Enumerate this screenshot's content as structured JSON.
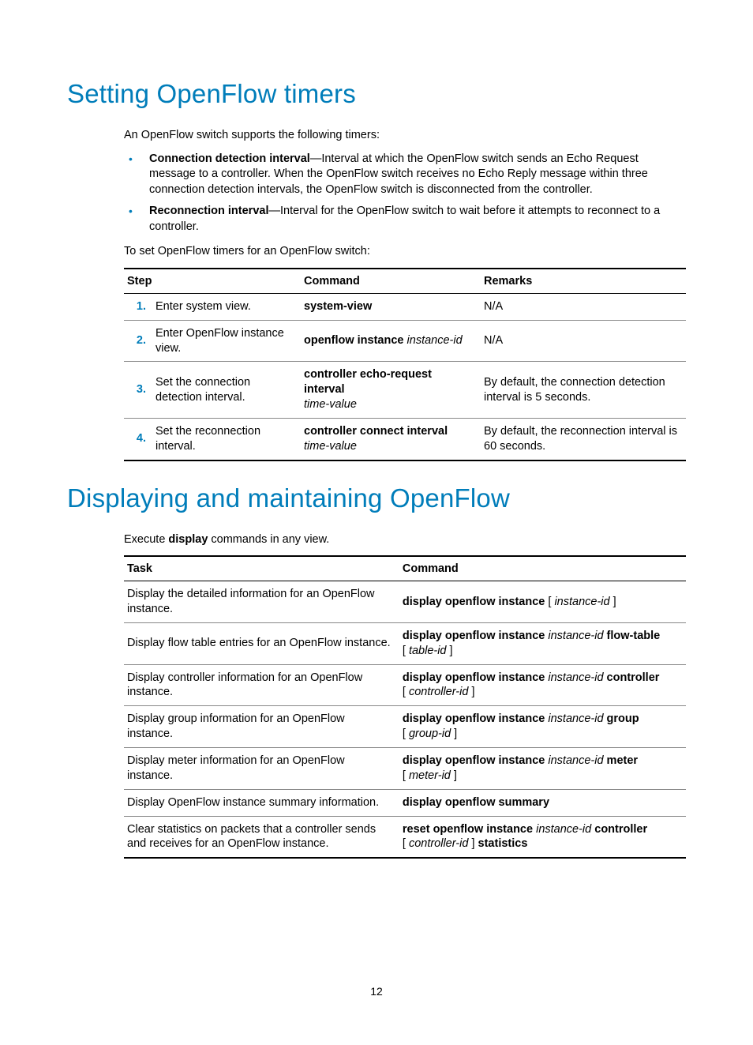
{
  "section1": {
    "heading": "Setting OpenFlow timers",
    "intro": "An OpenFlow switch supports the following timers:",
    "bullets": [
      {
        "label": "Connection detection interval",
        "text": "—Interval at which the OpenFlow switch sends an Echo Request message to a controller. When the OpenFlow switch receives no Echo Reply message within three connection detection intervals, the OpenFlow switch is disconnected from the controller."
      },
      {
        "label": "Reconnection interval",
        "text": "—Interval for the OpenFlow switch to wait before it attempts to reconnect to a controller."
      }
    ],
    "lead": "To set OpenFlow timers for an OpenFlow switch:",
    "table": {
      "headers": [
        "Step",
        "Command",
        "Remarks"
      ],
      "rows": [
        {
          "num": "1.",
          "step": "Enter system view.",
          "cmd": [
            {
              "b": "system-view"
            }
          ],
          "remarks": "N/A"
        },
        {
          "num": "2.",
          "step": "Enter OpenFlow instance view.",
          "cmd": [
            {
              "b": "openflow instance"
            },
            {
              "t": " "
            },
            {
              "i": "instance-id"
            }
          ],
          "remarks": "N/A"
        },
        {
          "num": "3.",
          "step": "Set the connection detection interval.",
          "cmd": [
            {
              "b": "controller echo-request interval"
            },
            {
              "br": true
            },
            {
              "i": "time-value"
            }
          ],
          "remarks": "By default, the connection detection interval is 5 seconds."
        },
        {
          "num": "4.",
          "step": "Set the reconnection interval.",
          "cmd": [
            {
              "b": "controller connect interval"
            },
            {
              "br": true
            },
            {
              "i": "time-value"
            }
          ],
          "remarks": "By default, the reconnection interval is 60 seconds."
        }
      ]
    }
  },
  "section2": {
    "heading": "Displaying and maintaining OpenFlow",
    "lead_pre": "Execute ",
    "lead_bold": "display",
    "lead_post": " commands in any view.",
    "table": {
      "headers": [
        "Task",
        "Command"
      ],
      "rows": [
        {
          "task": "Display the detailed information for an OpenFlow instance.",
          "cmd": [
            {
              "b": "display openflow instance"
            },
            {
              "t": " [ "
            },
            {
              "i": "instance-id"
            },
            {
              "t": " ]"
            }
          ]
        },
        {
          "task": "Display flow table entries for an OpenFlow instance.",
          "cmd": [
            {
              "b": "display openflow instance"
            },
            {
              "t": " "
            },
            {
              "i": "instance-id"
            },
            {
              "t": " "
            },
            {
              "b": "flow-table"
            },
            {
              "br": true
            },
            {
              "t": "[ "
            },
            {
              "i": "table-id"
            },
            {
              "t": " ]"
            }
          ]
        },
        {
          "task": "Display controller information for an OpenFlow instance.",
          "cmd": [
            {
              "b": "display openflow instance"
            },
            {
              "t": " "
            },
            {
              "i": "instance-id"
            },
            {
              "t": "  "
            },
            {
              "b": "controller"
            },
            {
              "br": true
            },
            {
              "t": "[ "
            },
            {
              "i": "controller-id"
            },
            {
              "t": " ]"
            }
          ]
        },
        {
          "task": "Display group information for an OpenFlow instance.",
          "cmd": [
            {
              "b": "display openflow instance"
            },
            {
              "t": " "
            },
            {
              "i": "instance-id"
            },
            {
              "t": " "
            },
            {
              "b": "group"
            },
            {
              "br": true
            },
            {
              "t": "[ "
            },
            {
              "i": "group-id"
            },
            {
              "t": " ]"
            }
          ]
        },
        {
          "task": "Display meter information for an OpenFlow instance.",
          "cmd": [
            {
              "b": "display openflow instance"
            },
            {
              "t": " "
            },
            {
              "i": "instance-id"
            },
            {
              "t": " "
            },
            {
              "b": "meter"
            },
            {
              "br": true
            },
            {
              "t": "[ "
            },
            {
              "i": "meter-id"
            },
            {
              "t": " ]"
            }
          ]
        },
        {
          "task": "Display OpenFlow instance summary information.",
          "cmd": [
            {
              "b": "display openflow summary"
            }
          ]
        },
        {
          "task": "Clear statistics on packets that a controller sends and receives for an OpenFlow instance.",
          "cmd": [
            {
              "b": "reset openflow instance"
            },
            {
              "t": " "
            },
            {
              "i": "instance-id"
            },
            {
              "t": " "
            },
            {
              "b": "controller"
            },
            {
              "br": true
            },
            {
              "t": "[ "
            },
            {
              "i": "controller-id"
            },
            {
              "t": " ] "
            },
            {
              "b": "statistics"
            }
          ]
        }
      ]
    }
  },
  "page_number": "12"
}
